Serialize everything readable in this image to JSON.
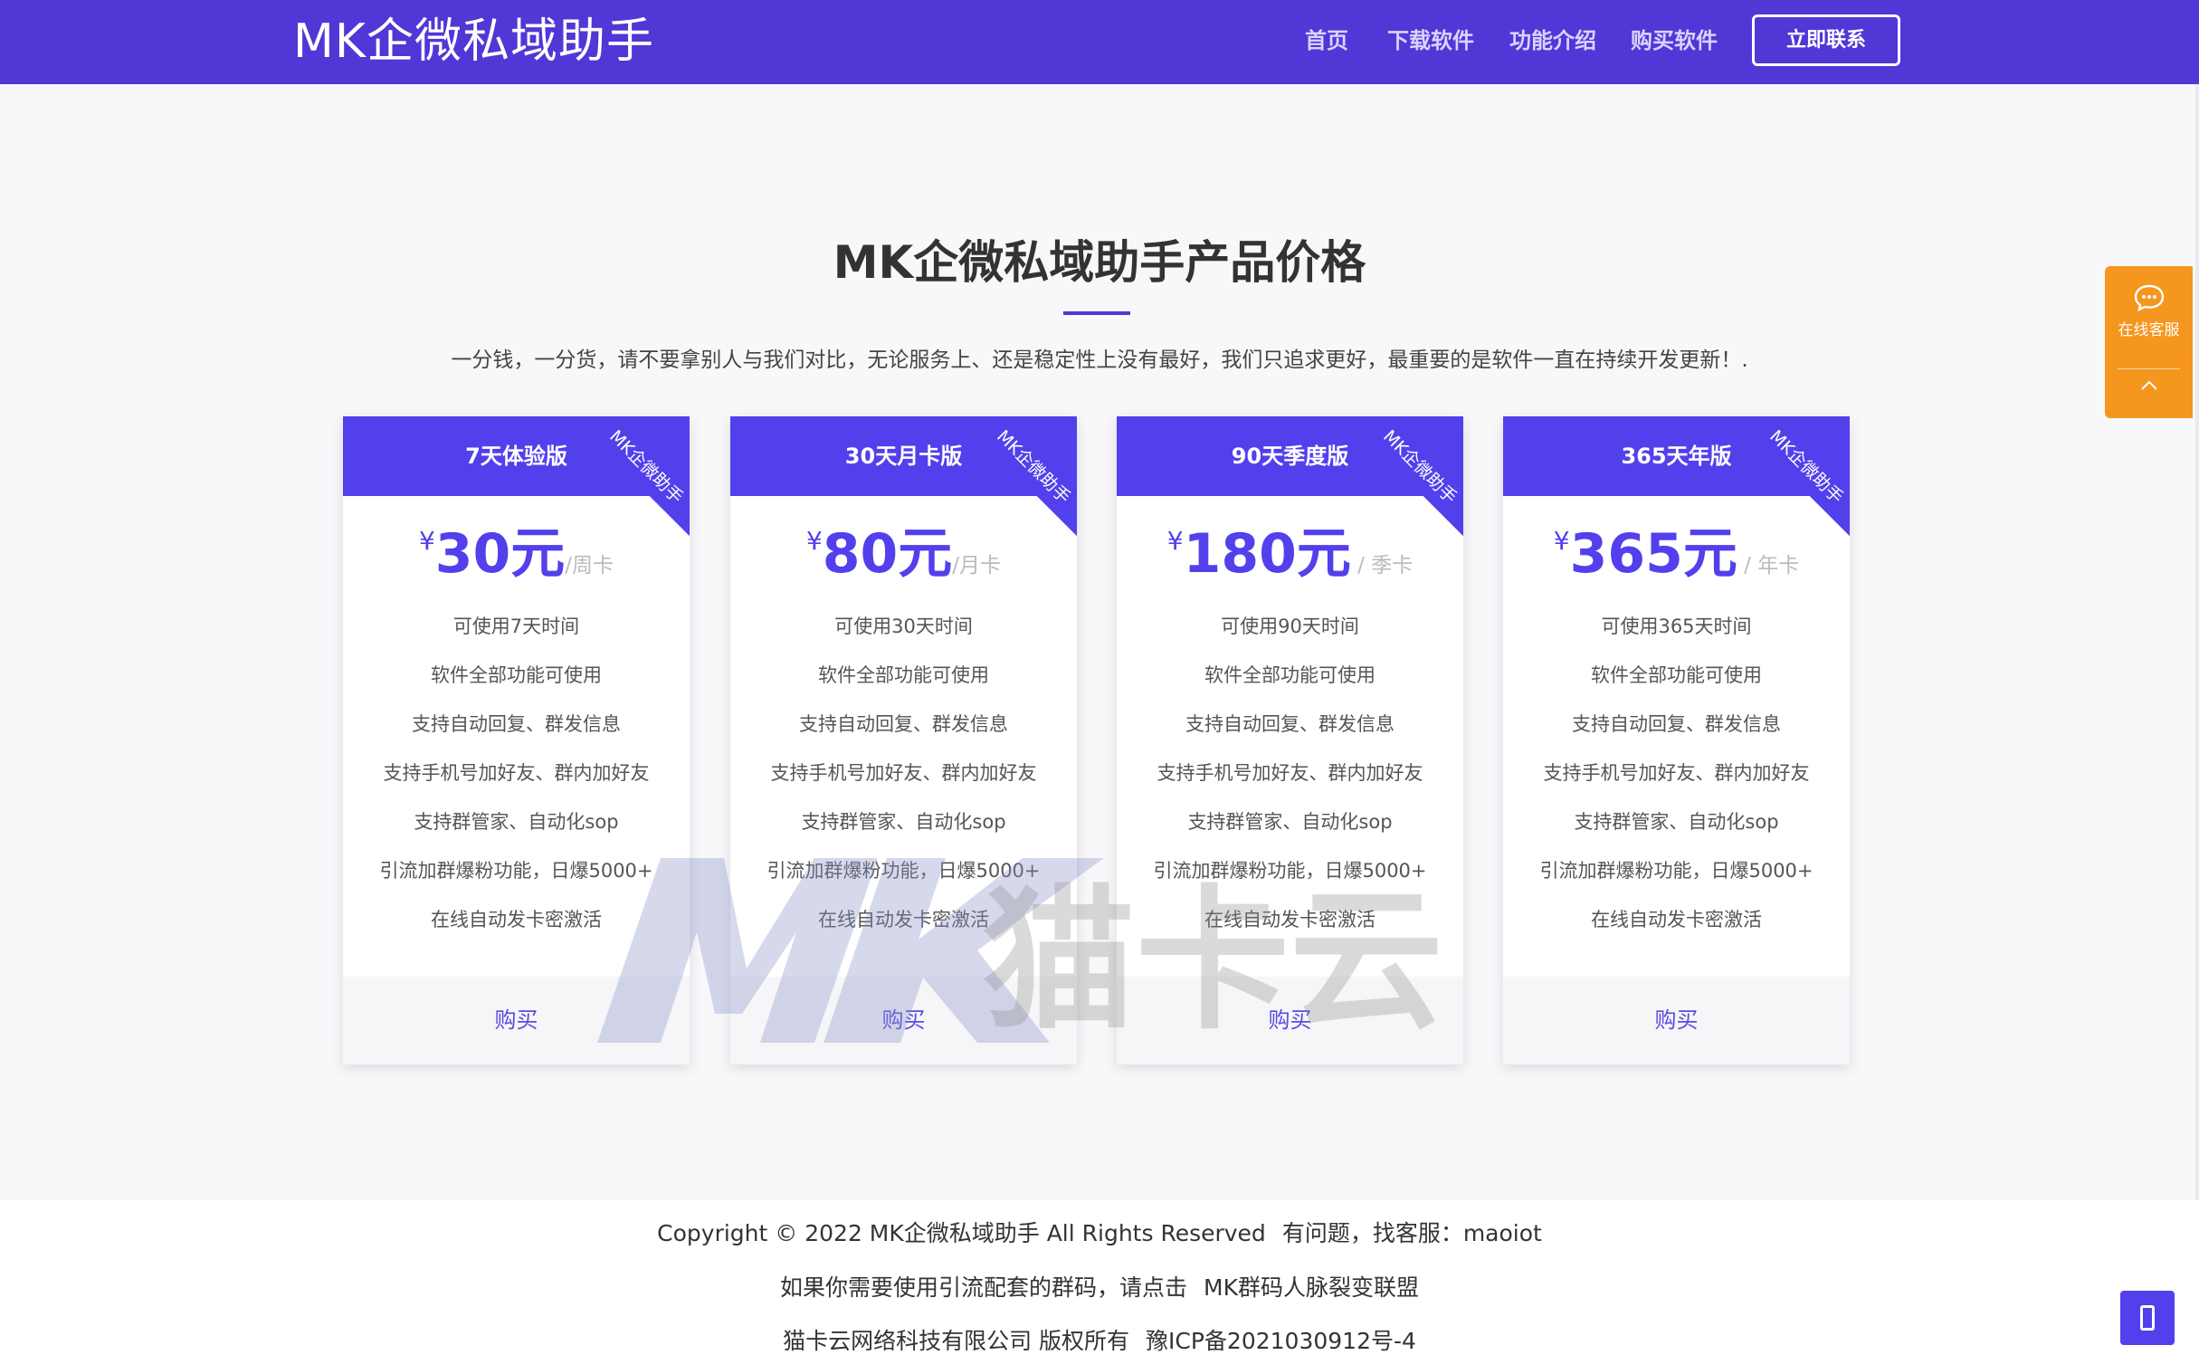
{
  "header": {
    "brand": "MK企微私域助手",
    "nav": [
      "首页",
      "下载软件",
      "功能介绍",
      "购买软件"
    ],
    "contact": "立即联系"
  },
  "section": {
    "title": "MK企微私域助手产品价格",
    "subtitle": "一分钱，一分货，请不要拿别人与我们对比，无论服务上、还是稳定性上没有最好，我们只追求更好，最重要的是软件一直在持续开发更新！."
  },
  "plans": [
    {
      "name": "7天体验版",
      "ribbon": "MK企微助手",
      "currency": "¥",
      "price": "30元",
      "period": "/周卡",
      "features": [
        "可使用7天时间",
        "软件全部功能可使用",
        "支持自动回复、群发信息",
        "支持手机号加好友、群内加好友",
        "支持群管家、自动化sop",
        "引流加群爆粉功能，日爆5000+",
        "在线自动发卡密激活"
      ],
      "buy": "购买"
    },
    {
      "name": "30天月卡版",
      "ribbon": "MK企微助手",
      "currency": "¥",
      "price": "80元",
      "period": "/月卡",
      "features": [
        "可使用30天时间",
        "软件全部功能可使用",
        "支持自动回复、群发信息",
        "支持手机号加好友、群内加好友",
        "支持群管家、自动化sop",
        "引流加群爆粉功能，日爆5000+",
        "在线自动发卡密激活"
      ],
      "buy": "购买"
    },
    {
      "name": "90天季度版",
      "ribbon": "MK企微助手",
      "currency": "¥",
      "price": "180元",
      "period": " / 季卡",
      "features": [
        "可使用90天时间",
        "软件全部功能可使用",
        "支持自动回复、群发信息",
        "支持手机号加好友、群内加好友",
        "支持群管家、自动化sop",
        "引流加群爆粉功能，日爆5000+",
        "在线自动发卡密激活"
      ],
      "buy": "购买"
    },
    {
      "name": "365天年版",
      "ribbon": "MK企微助手",
      "currency": "¥",
      "price": "365元",
      "period": " / 年卡",
      "features": [
        "可使用365天时间",
        "软件全部功能可使用",
        "支持自动回复、群发信息",
        "支持手机号加好友、群内加好友",
        "支持群管家、自动化sop",
        "引流加群爆粉功能，日爆5000+",
        "在线自动发卡密激活"
      ],
      "buy": "购买"
    }
  ],
  "watermark": {
    "logo": "MK",
    "text": "猫卡云"
  },
  "side": {
    "label": "在线客服",
    "chat_icon": "chat-bubble-icon",
    "up_icon": "chevron-up-icon"
  },
  "footer": {
    "copyright": "Copyright © 2022 MK企微私域助手 All Rights Reserved",
    "support": "有问题，找客服：maoiot",
    "promo_prefix": "如果你需要使用引流配套的群码，请点击",
    "promo_link": "MK群码人脉裂变联盟",
    "company": "猫卡云网络科技有限公司 版权所有",
    "icp": "豫ICP备2021030912号-4"
  },
  "colors": {
    "header": "#5236d6",
    "accent": "#5240ec",
    "side_widget": "#f5961f",
    "background": "#f8f8fb"
  }
}
